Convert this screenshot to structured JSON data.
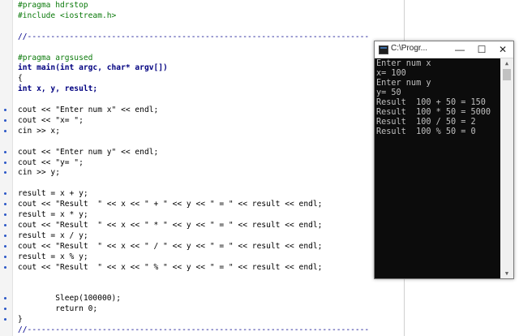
{
  "editor": {
    "lines": [
      {
        "text": "#pragma hdrstop",
        "style": "green"
      },
      {
        "text": "#include <iostream.h>",
        "style": "green"
      },
      {
        "text": "",
        "style": "plain"
      },
      {
        "text": "//-------------------------------------------------------------------------",
        "style": "blue"
      },
      {
        "text": "",
        "style": "plain"
      },
      {
        "text": "#pragma argsused",
        "style": "green"
      },
      {
        "text": "int main(int argc, char* argv[])",
        "style": "bold"
      },
      {
        "text": "{",
        "style": "plain"
      },
      {
        "text": "int x, y, result;",
        "style": "bold"
      },
      {
        "text": "",
        "style": "plain"
      },
      {
        "text": "cout << \"Enter num x\" << endl;",
        "style": "code"
      },
      {
        "text": "cout << \"x= \";",
        "style": "code"
      },
      {
        "text": "cin >> x;",
        "style": "code"
      },
      {
        "text": "",
        "style": "plain"
      },
      {
        "text": "cout << \"Enter num y\" << endl;",
        "style": "code"
      },
      {
        "text": "cout << \"y= \";",
        "style": "code"
      },
      {
        "text": "cin >> y;",
        "style": "code"
      },
      {
        "text": "",
        "style": "plain"
      },
      {
        "text": "result = x + y;",
        "style": "code"
      },
      {
        "text": "cout << \"Result  \" << x << \" + \" << y << \" = \" << result << endl;",
        "style": "code"
      },
      {
        "text": "result = x * y;",
        "style": "code"
      },
      {
        "text": "cout << \"Result  \" << x << \" * \" << y << \" = \" << result << endl;",
        "style": "code"
      },
      {
        "text": "result = x / y;",
        "style": "code"
      },
      {
        "text": "cout << \"Result  \" << x << \" / \" << y << \" = \" << result << endl;",
        "style": "code"
      },
      {
        "text": "result = x % y;",
        "style": "code"
      },
      {
        "text": "cout << \"Result  \" << x << \" % \" << y << \" = \" << result << endl;",
        "style": "code"
      },
      {
        "text": "",
        "style": "plain"
      },
      {
        "text": "",
        "style": "plain"
      },
      {
        "text": "        Sleep(100000);",
        "style": "code"
      },
      {
        "text": "        return 0;",
        "style": "code"
      },
      {
        "text": "}",
        "style": "plain"
      },
      {
        "text": "//-------------------------------------------------------------------------",
        "style": "blue"
      }
    ],
    "breakpoint_lines": [
      10,
      11,
      12,
      14,
      15,
      16,
      18,
      19,
      20,
      21,
      22,
      23,
      24,
      25,
      28,
      29,
      30
    ]
  },
  "console": {
    "title": "C:\\Progr...",
    "minimize_label": "—",
    "maximize_label": "☐",
    "close_label": "✕",
    "output": [
      "Enter num x",
      "x= 100",
      "Enter num y",
      "y= 50",
      "Result  100 + 50 = 150",
      "Result  100 * 50 = 5000",
      "Result  100 / 50 = 2",
      "Result  100 % 50 = 0"
    ]
  }
}
